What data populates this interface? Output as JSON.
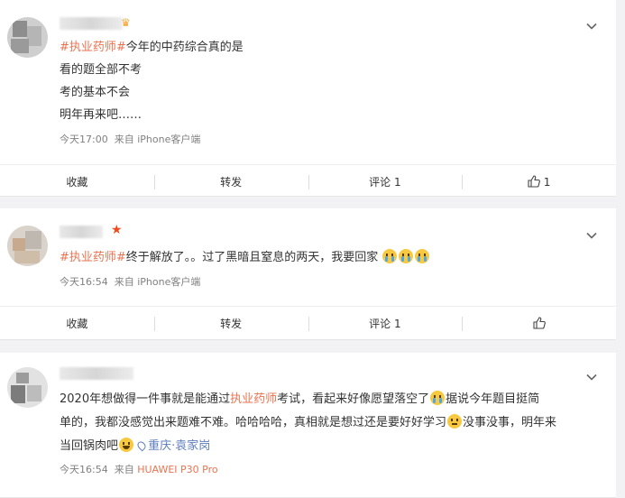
{
  "posts": [
    {
      "hashtag": "#执业药师#",
      "lines": [
        "今年的中药综合真的是",
        "看的题全部不考",
        "考的基本不会",
        "明年再来吧……"
      ],
      "time": "今天17:00",
      "source_prefix": "来自",
      "source": "iPhone客户端",
      "actions": {
        "favorite": "收藏",
        "repost": "转发",
        "comment": "评论 1",
        "like_count": "1"
      }
    },
    {
      "hashtag": "#执业药师#",
      "text": "终于解放了。。过了黑暗且窒息的两天，我要回家",
      "time": "今天16:54",
      "source_prefix": "来自",
      "source": "iPhone客户端",
      "actions": {
        "favorite": "收藏",
        "repost": "转发",
        "comment": "评论 1",
        "like_count": ""
      }
    },
    {
      "line1_before": "2020年想做得一件事就是能通过",
      "hashtag": "执业药师",
      "line1_after": "考试，看起来好像愿望落空了",
      "line1_tail": "据说今年题目挺简",
      "line2_before": "单的，我都没感觉出来题难不难。哈哈哈哈，真相就是想过还是要好好学习",
      "line2_after": "没事没事，明年来",
      "line3": "当回锅肉吧",
      "location": "重庆·袁家岗",
      "time": "今天16:54",
      "source_prefix": "来自",
      "source": "HUAWEI P30 Pro"
    }
  ],
  "colors": {
    "hashtag": "#eb7350",
    "location": "#5d7dbf",
    "meta": "#808080"
  },
  "icons": [
    "chevron-down-icon",
    "thumbs-up-icon",
    "crown-icon",
    "star-icon",
    "location-pin-icon"
  ]
}
